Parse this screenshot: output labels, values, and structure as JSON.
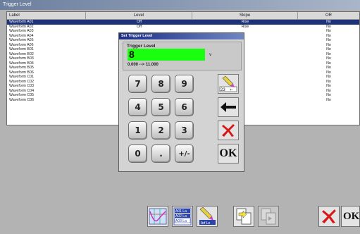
{
  "window": {
    "title": "Trigger Level"
  },
  "table": {
    "headers": {
      "label": "Label",
      "level": "Level",
      "slope": "Slope",
      "or": "OR"
    },
    "rows": [
      {
        "label": "Waveform A01",
        "level": "Off",
        "slope": "Rise",
        "or": "No",
        "selected": true
      },
      {
        "label": "Waveform A02",
        "level": "Off",
        "slope": "Rise",
        "or": "No"
      },
      {
        "label": "Waveform A03",
        "level": "",
        "slope": "",
        "or": "No"
      },
      {
        "label": "Waveform A04",
        "level": "",
        "slope": "",
        "or": "No"
      },
      {
        "label": "Waveform A05",
        "level": "",
        "slope": "",
        "or": "No"
      },
      {
        "label": "Waveform A06",
        "level": "",
        "slope": "",
        "or": "No"
      },
      {
        "label": "Waveform B01",
        "level": "",
        "slope": "",
        "or": "No"
      },
      {
        "label": "Waveform B02",
        "level": "",
        "slope": "",
        "or": "No"
      },
      {
        "label": "Waveform B03",
        "level": "",
        "slope": "",
        "or": "No"
      },
      {
        "label": "Waveform B04",
        "level": "",
        "slope": "",
        "or": "No"
      },
      {
        "label": "Waveform B05",
        "level": "",
        "slope": "",
        "or": "No"
      },
      {
        "label": "Waveform B06",
        "level": "",
        "slope": "",
        "or": "No"
      },
      {
        "label": "Waveform C01",
        "level": "",
        "slope": "",
        "or": "No"
      },
      {
        "label": "Waveform C02",
        "level": "",
        "slope": "",
        "or": "No"
      },
      {
        "label": "Waveform C03",
        "level": "",
        "slope": "",
        "or": "No"
      },
      {
        "label": "Waveform C04",
        "level": "",
        "slope": "",
        "or": "No"
      },
      {
        "label": "Waveform C05",
        "level": "",
        "slope": "",
        "or": "No"
      },
      {
        "label": "Waveform C06",
        "level": "",
        "slope": "",
        "or": "No"
      }
    ]
  },
  "dialog": {
    "title": "Set Trigger Level",
    "field_label": "Trigger Level",
    "value": "8",
    "unit": "v",
    "range": "0.000 --> 11.000",
    "keys": [
      "7",
      "8",
      "9",
      "4",
      "5",
      "6",
      "1",
      "2",
      "3",
      "0",
      ".",
      "+/-"
    ],
    "ok_label": "OK",
    "pen_key_text": "23",
    "pen_key_sub": "+-"
  },
  "toolbar": {
    "ok_label": "OK",
    "list_icon_lines": [
      "A01 La",
      "A02 La",
      "A03 La"
    ],
    "edit_icon_text": "Arf Le"
  },
  "colors": {
    "selection": "#1e327a",
    "entry_field": "#19ff0f",
    "dialog_title": "#1c2f86",
    "cancel_red": "#d61818"
  }
}
